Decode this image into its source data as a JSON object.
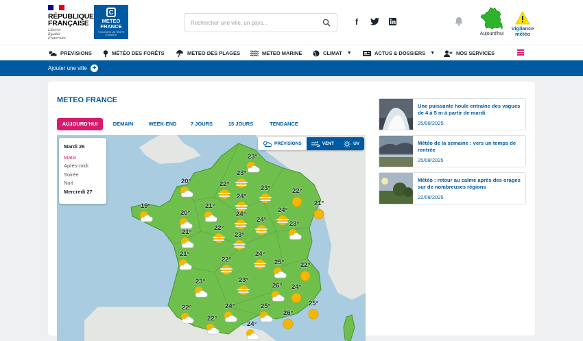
{
  "header": {
    "republique": [
      "RÉPUBLIQUE",
      "FRANÇAISE"
    ],
    "motto": [
      "Liberté",
      "Égalité",
      "Fraternité"
    ],
    "logo_title": [
      "METEO",
      "FRANCE"
    ],
    "logo_sub": [
      "TOUJOURS UN TEMPS",
      "D'AVANCE"
    ],
    "search_placeholder": "Rechercher une ville, un pays...",
    "social_icons": [
      "facebook-icon",
      "twitter-icon",
      "linkedin-icon"
    ],
    "today_label": "Aujourd'hui",
    "vigilance_label": "Vigilance météo",
    "vigilance_color": "#ffe000",
    "today_map_color": "#2bb32b"
  },
  "nav": {
    "items": [
      "PREVISIONS",
      "MÉTÉO DES FORÊTS",
      "METEO DES PLAGES",
      "METEO MARINE",
      "CLIMAT",
      "ACTUS & DOSSIERS",
      "NOS SERVICES"
    ]
  },
  "bar": {
    "add_city": "Ajouter une ville"
  },
  "main": {
    "title": "METEO FRANCE",
    "tabs": [
      "AUJOURD'HUI",
      "DEMAIN",
      "WEEK-END",
      "7 JOURS",
      "15 JOURS",
      "TENDANCE"
    ],
    "active_tab": 0,
    "periods": {
      "day1": "Mardi 26",
      "items": [
        "Matin",
        "Après-midi",
        "Soirée",
        "Nuit"
      ],
      "day2": "Mercredi 27",
      "active": 0
    },
    "map_buttons": [
      "PRÉVISIONS",
      "VENT",
      "UV"
    ],
    "map_points": [
      {
        "t": "23°",
        "w": "sun-cloud"
      },
      {
        "t": "23°",
        "w": "sun-fog"
      },
      {
        "t": "20°",
        "w": "sun-cloud"
      },
      {
        "t": "22°",
        "w": "sun-fog"
      },
      {
        "t": "23°",
        "w": "sun-fog"
      },
      {
        "t": "22°",
        "w": "sun"
      },
      {
        "t": "24°",
        "w": "sun-fog"
      },
      {
        "t": "21°",
        "w": "sun"
      },
      {
        "t": "19°",
        "w": "sun-cloud"
      },
      {
        "t": "20°",
        "w": "sun-cloud"
      },
      {
        "t": "21°",
        "w": "sun-cloud"
      },
      {
        "t": "24°",
        "w": "sun-fog"
      },
      {
        "t": "24°",
        "w": "sun-fog"
      },
      {
        "t": "23°",
        "w": "sun-cloud"
      },
      {
        "t": "21°",
        "w": "sun-cloud"
      },
      {
        "t": "22°",
        "w": "sun-fog"
      },
      {
        "t": "24°",
        "w": "sun-fog"
      },
      {
        "t": "23°",
        "w": "sun-fog"
      },
      {
        "t": "21°",
        "w": "sun-cloud"
      },
      {
        "t": "24°",
        "w": "sun-fog"
      },
      {
        "t": "22°",
        "w": "sun-fog"
      },
      {
        "t": "25°",
        "w": "sun-cloud"
      },
      {
        "t": "22°",
        "w": "sun"
      },
      {
        "t": "23°",
        "w": "sun-cloud"
      },
      {
        "t": "23°",
        "w": "sun-fog"
      },
      {
        "t": "26°",
        "w": "sun-cloud"
      },
      {
        "t": "24°",
        "w": "sun"
      },
      {
        "t": "22°",
        "w": "sun-cloud"
      },
      {
        "t": "24°",
        "w": "sun-cloud"
      },
      {
        "t": "25°",
        "w": "sun-cloud"
      },
      {
        "t": "26°",
        "w": "sun"
      },
      {
        "t": "25°",
        "w": "sun"
      },
      {
        "t": "22°",
        "w": "sun-cloud"
      },
      {
        "t": "24°",
        "w": "sun-cloud"
      }
    ]
  },
  "news": [
    {
      "title": "Une puissante houle entraîne des vagues de 4 à 5 m à partir de mardi",
      "date": "25/08/2025"
    },
    {
      "title": "Météo de la semaine : vers un temps de rentrée",
      "date": "25/08/2025"
    },
    {
      "title": "Météo : retour au calme après des orages sur de nombreuses régions",
      "date": "22/08/2025"
    }
  ],
  "colors": {
    "accent": "#d81a6e",
    "primary": "#005aa2",
    "land": "#6fbf4c",
    "sea": "#a9cce1"
  }
}
